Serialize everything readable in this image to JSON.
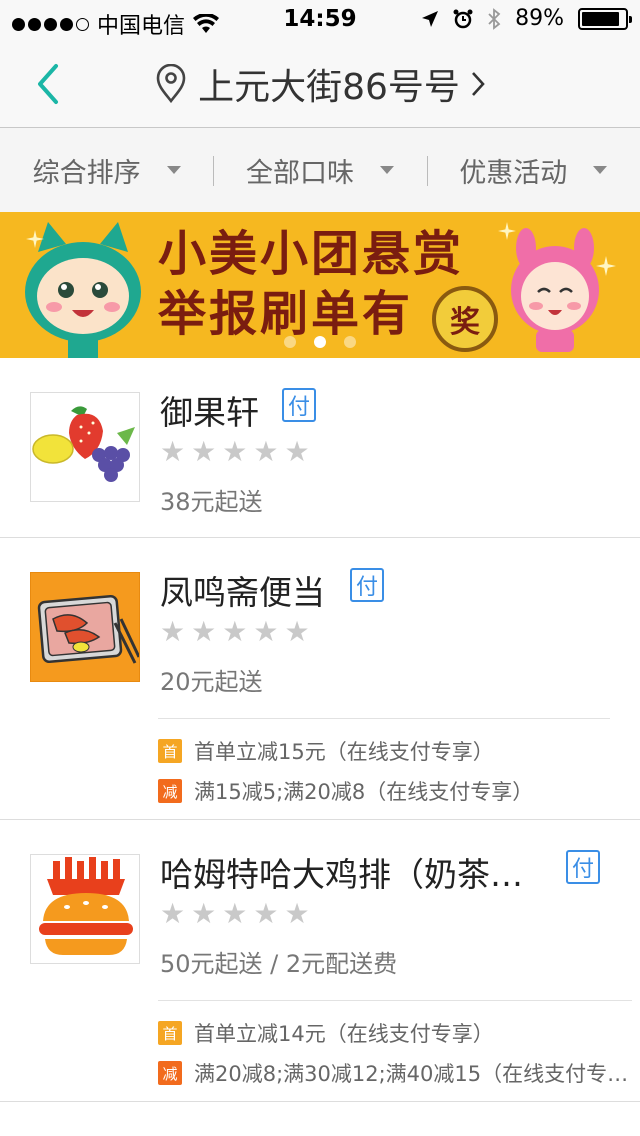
{
  "status_bar": {
    "carrier": "中国电信",
    "time": "14:59",
    "battery": "89%",
    "battery_level": 0.89
  },
  "navbar": {
    "title": "上元大街86号号"
  },
  "filters": [
    {
      "label": "综合排序"
    },
    {
      "label": "全部口味"
    },
    {
      "label": "优惠活动"
    }
  ],
  "banner": {
    "line1": "小美小团悬赏",
    "line2": "举报刷单有",
    "prize": "奖",
    "page_count": 3,
    "active_page": 2
  },
  "shops": [
    {
      "name": "御果轩",
      "pay_badge": "付",
      "rating": 0,
      "min_order": "38元起送",
      "promos": []
    },
    {
      "name": "凤鸣斋便当",
      "pay_badge": "付",
      "rating": 0,
      "min_order": "20元起送",
      "promos": [
        {
          "tag": "首",
          "text": "首单立减15元（在线支付专享）"
        },
        {
          "tag": "减",
          "text": "满15减5;满20减8（在线支付专享）"
        }
      ]
    },
    {
      "name": "哈姆特哈大鸡排（奶茶…",
      "pay_badge": "付",
      "rating": 0,
      "min_order": "50元起送 / 2元配送费",
      "promos": [
        {
          "tag": "首",
          "text": "首单立减14元（在线支付专享）"
        },
        {
          "tag": "减",
          "text": "满20减8;满30减12;满40减15（在线支付专…"
        }
      ]
    }
  ],
  "colors": {
    "accent": "#1bb6a6",
    "banner_bg": "#f6b820",
    "pay_blue": "#3a8ee6",
    "tag_first": "#f5a623",
    "tag_reduce": "#f26b1d"
  }
}
